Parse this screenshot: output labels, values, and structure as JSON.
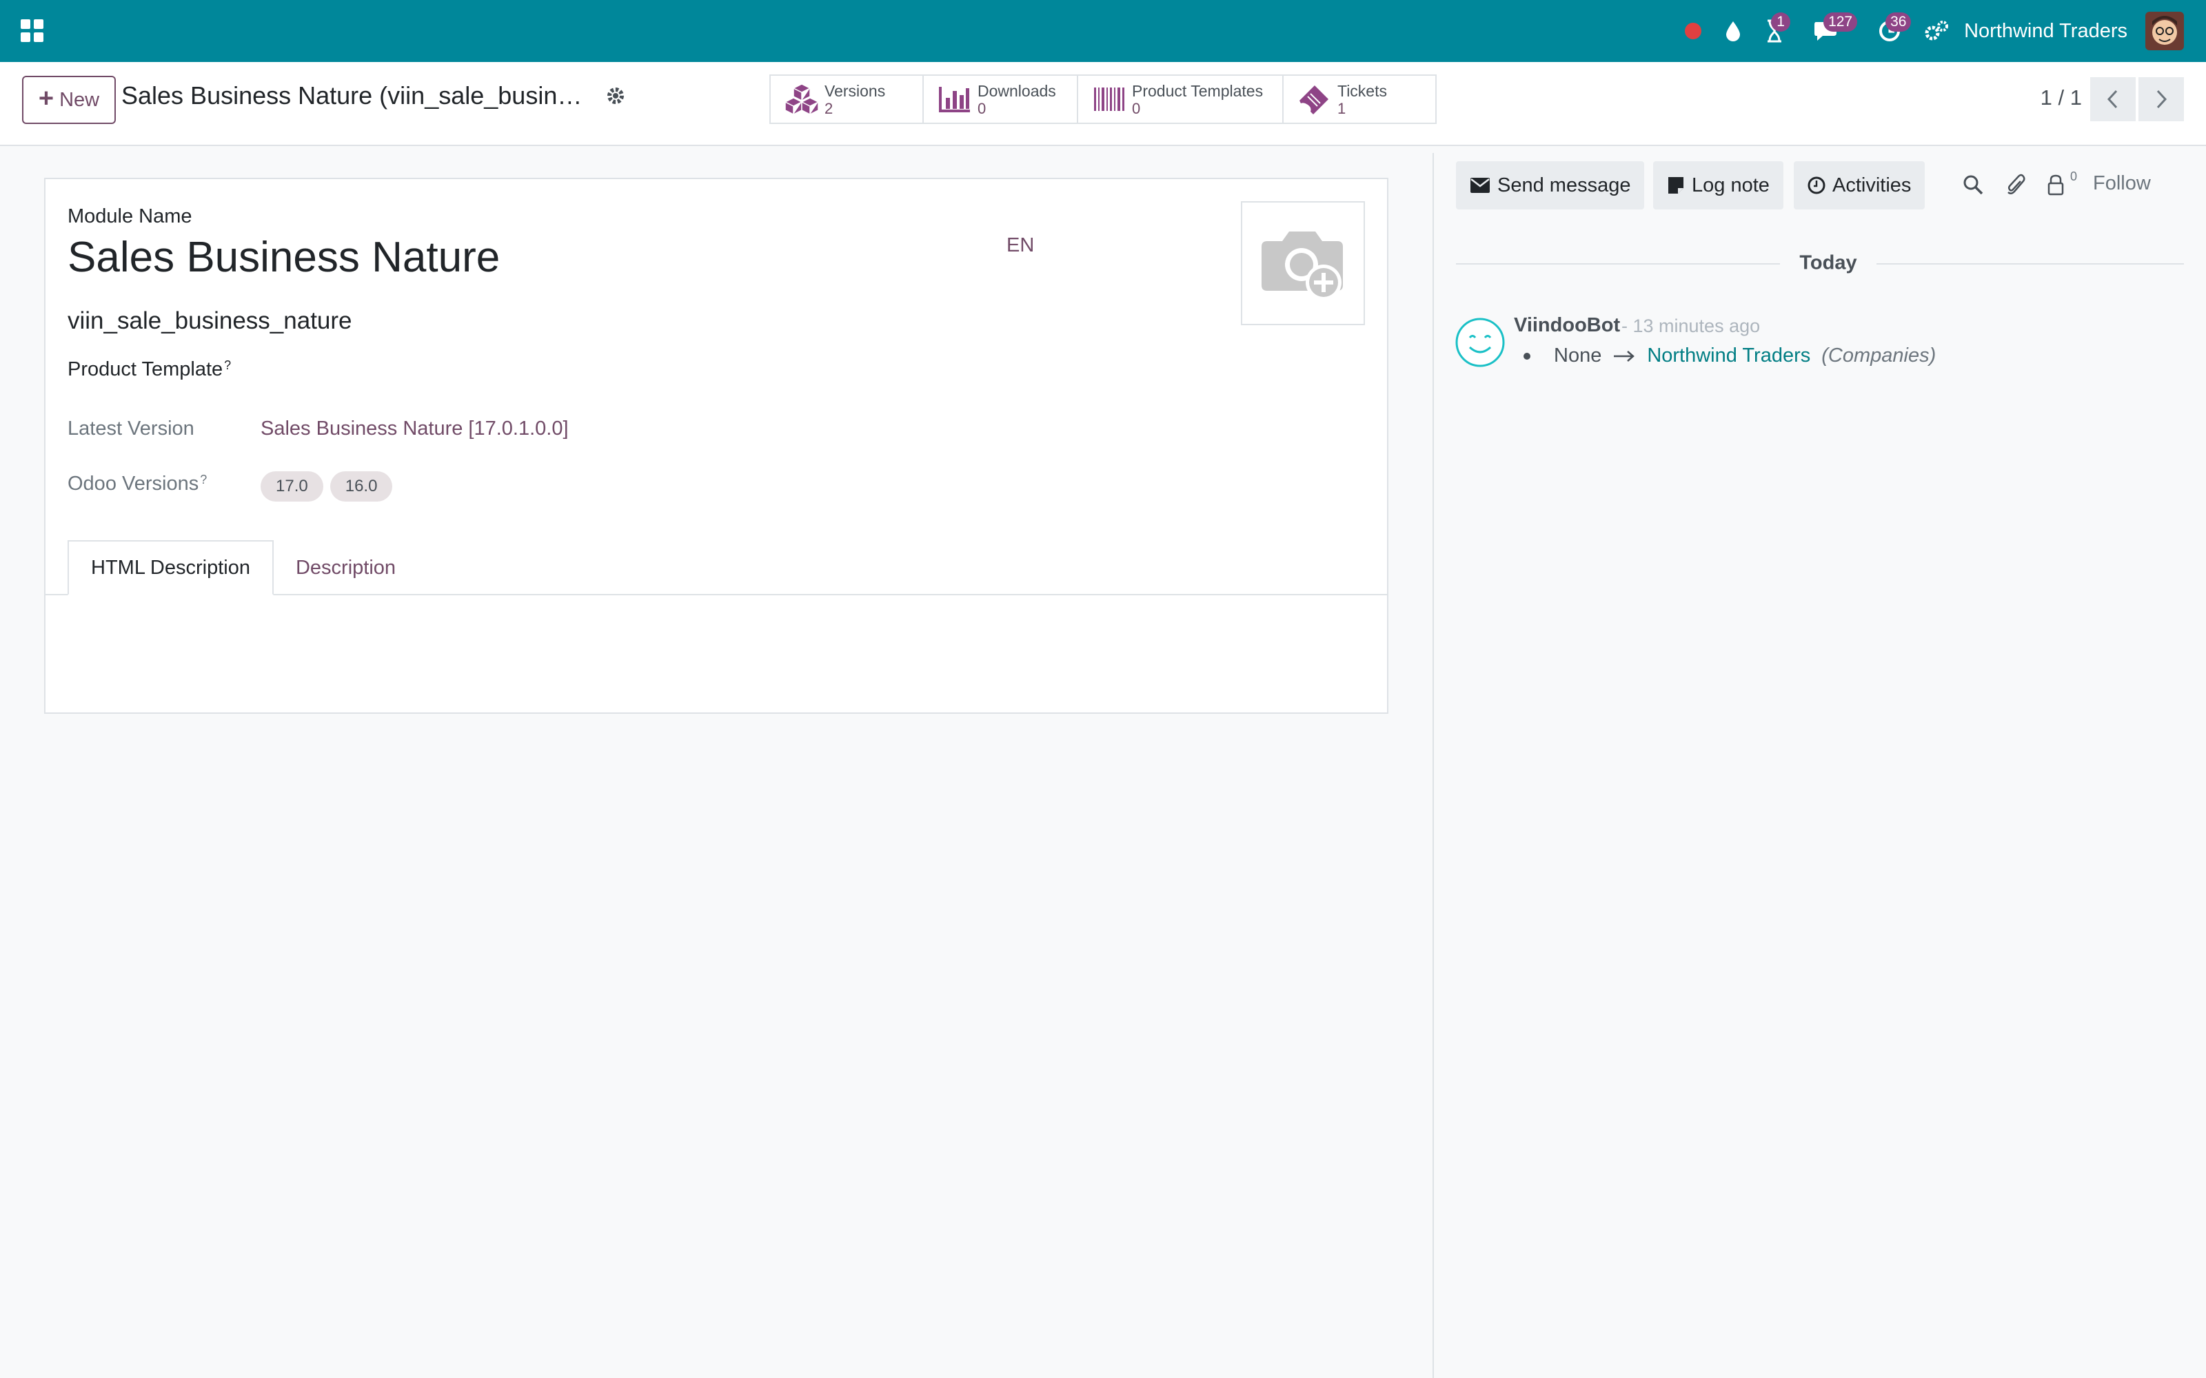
{
  "navbar": {
    "company": "Northwind Traders",
    "activity_badge": "1",
    "messages_badge": "127",
    "clock_badge": "36",
    "colors": {
      "bar": "#00879a",
      "badge": "#8e4486",
      "record_dot": "#e04040"
    },
    "icons": [
      "apps-grid-icon",
      "record-dot-icon",
      "drop-icon",
      "hourglass-icon",
      "chat-icon",
      "clock-icon",
      "settings-icon"
    ]
  },
  "control_panel": {
    "new_label": "New",
    "title": "Sales Business Nature (viin_sale_business_nature)",
    "smart_buttons": [
      {
        "label": "Versions",
        "value": "2",
        "icon": "cubes-icon"
      },
      {
        "label": "Downloads",
        "value": "0",
        "icon": "bar-chart-icon"
      },
      {
        "label": "Product Templates",
        "value": "0",
        "icon": "barcode-icon"
      },
      {
        "label": "Tickets",
        "value": "1",
        "icon": "ticket-icon"
      }
    ],
    "pager": "1 / 1"
  },
  "form": {
    "name_caption": "Module Name",
    "name": "Sales Business Nature",
    "lang": "EN",
    "technical_name": "viin_sale_business_nature",
    "product_template_label": "Product Template",
    "help_mark": "?",
    "latest_version_label": "Latest Version",
    "latest_version_value": "Sales Business Nature [17.0.1.0.0]",
    "odoo_versions_label": "Odoo Versions",
    "odoo_versions": [
      "17.0",
      "16.0"
    ],
    "tabs": [
      {
        "label": "HTML Description",
        "active": true
      },
      {
        "label": "Description",
        "active": false
      }
    ]
  },
  "chatter": {
    "send_message": "Send message",
    "log_note": "Log note",
    "activities": "Activities",
    "follower_count": "0",
    "follow": "Follow",
    "date_separator": "Today",
    "messages": [
      {
        "author": "ViindooBot",
        "time": "- 13 minutes ago",
        "old_value": "None",
        "new_value": "Northwind Traders",
        "field": "(Companies)"
      }
    ]
  }
}
